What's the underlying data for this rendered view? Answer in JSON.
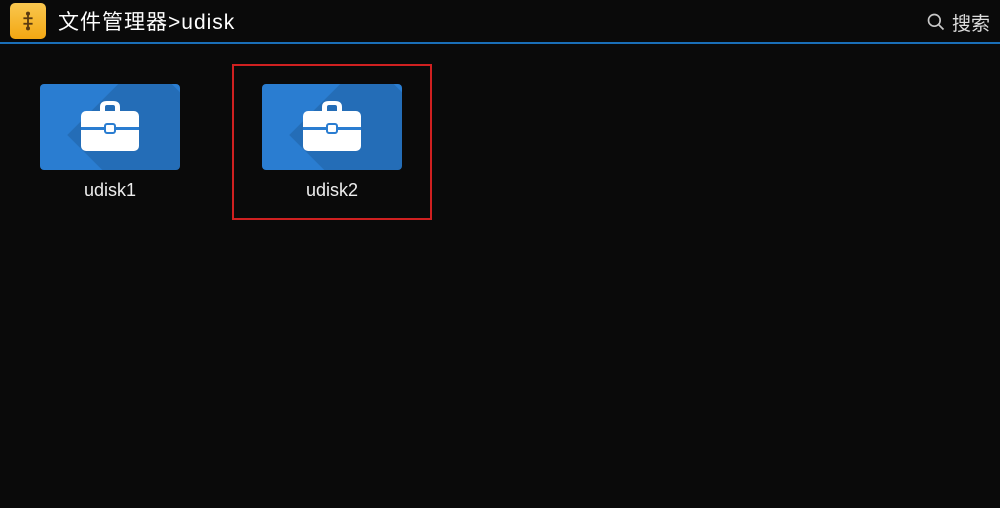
{
  "header": {
    "breadcrumb": "文件管理器>udisk",
    "search_label": "搜索"
  },
  "items": [
    {
      "label": "udisk1",
      "selected": false
    },
    {
      "label": "udisk2",
      "selected": true
    }
  ]
}
